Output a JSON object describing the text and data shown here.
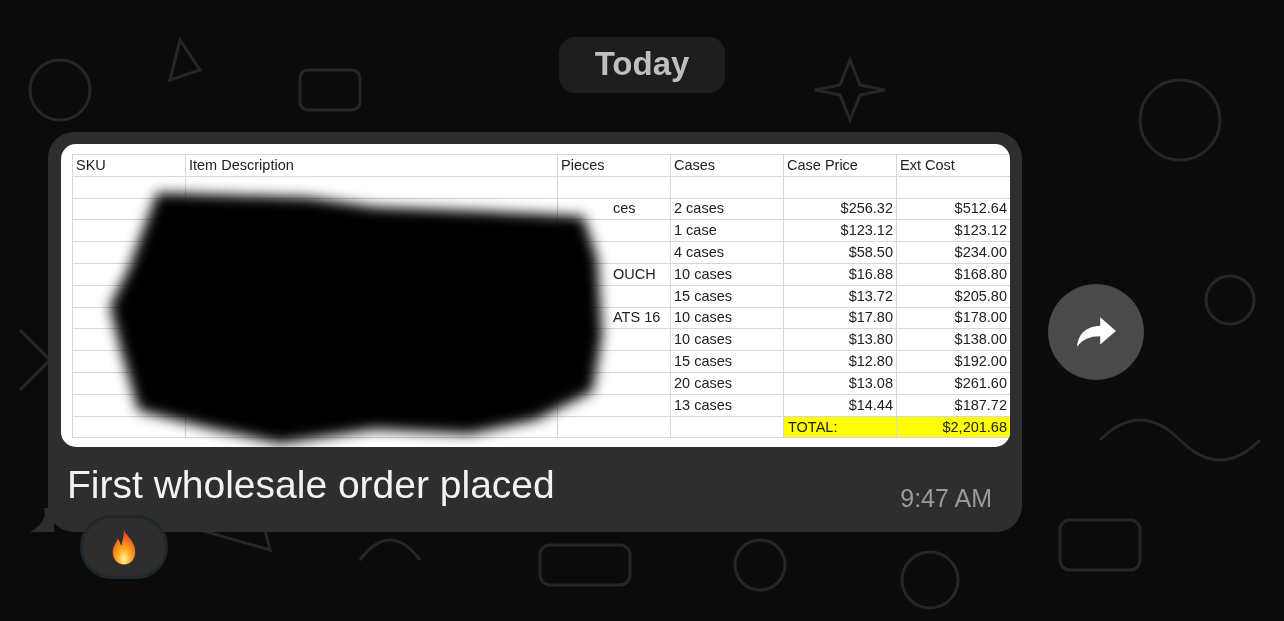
{
  "date_chip": "Today",
  "message": {
    "attachment": {
      "kind": "spreadsheet",
      "columns": [
        "SKU",
        "Item Description",
        "Pieces",
        "Cases",
        "Case Price",
        "Ext Cost"
      ],
      "rows": [
        {
          "cells": [
            "",
            "",
            "",
            "",
            "",
            ""
          ]
        },
        {
          "cells": [
            "",
            "",
            "ces",
            "2 cases",
            "$256.32",
            "$512.64"
          ]
        },
        {
          "cells": [
            "",
            "",
            "",
            "1 case",
            "$123.12",
            "$123.12"
          ]
        },
        {
          "cells": [
            "",
            "",
            "",
            "4 cases",
            "$58.50",
            "$234.00"
          ]
        },
        {
          "cells": [
            "",
            "",
            "OUCH",
            "10 cases",
            "$16.88",
            "$168.80"
          ]
        },
        {
          "cells": [
            "",
            "",
            "",
            "15 cases",
            "$13.72",
            "$205.80"
          ]
        },
        {
          "cells": [
            "",
            "",
            "ATS 16",
            "10 cases",
            "$17.80",
            "$178.00"
          ]
        },
        {
          "cells": [
            "",
            "",
            "",
            "10 cases",
            "$13.80",
            "$138.00"
          ]
        },
        {
          "cells": [
            "",
            "",
            "",
            "15 cases",
            "$12.80",
            "$192.00"
          ]
        },
        {
          "cells": [
            "",
            "",
            "",
            "20 cases",
            "$13.08",
            "$261.60"
          ]
        },
        {
          "cells": [
            "",
            "",
            "",
            "13 cases",
            "$14.44",
            "$187.72"
          ]
        }
      ],
      "total": {
        "label": "TOTAL:",
        "value": "$2,201.68"
      }
    },
    "text": "First wholesale order placed",
    "time": "9:47 AM"
  }
}
